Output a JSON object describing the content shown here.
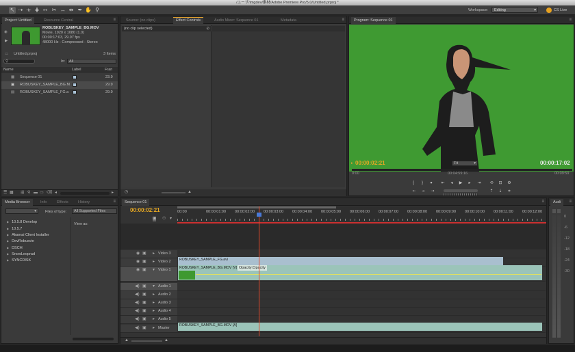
{
  "titlebar": {
    "title": "/ユーザ/imgdev/素材/Adobe Premiere Pro/5.0/Untitled.prproj *"
  },
  "toolbar": {
    "workspace_label": "Workspace:",
    "workspace_value": "Editing",
    "cs_live": "CS Live",
    "tools": [
      "selection-tool",
      "track-select-tool",
      "ripple-edit-tool",
      "rolling-edit-tool",
      "rate-stretch-tool",
      "razor-tool",
      "slip-tool",
      "slide-tool",
      "pen-tool",
      "hand-tool",
      "zoom-tool"
    ]
  },
  "project_panel": {
    "tabs": [
      "Project: Untitled",
      "Resource Central"
    ],
    "clip_name": "ROBUSKEY_SAMPLE_BG.MOV",
    "clip_info": [
      "Movie, 1920 x 1080 (1.0)",
      "00:00:17:03, 29.97 fps",
      "48000 Hz - Compressed - Stereo"
    ],
    "project_file": "Untitled.prproj",
    "item_count": "3 Items",
    "in_label": "In:",
    "in_value": "All",
    "columns": [
      "Name",
      "Label",
      "Fran"
    ],
    "items": [
      {
        "name": "Sequence 01",
        "label_color": "#a9c2d6",
        "rate": "23.9"
      },
      {
        "name": "ROBUSKEY_SAMPLE_BG.M",
        "label_color": "#a9c2d6",
        "rate": "29.9"
      },
      {
        "name": "ROBUSKEY_SAMPLE_FG.a",
        "label_color": "#a9c2d6",
        "rate": "29.9"
      }
    ]
  },
  "effect_panel": {
    "tabs": [
      "Source: (no clips)",
      "Effect Controls",
      "Audio Mixer: Sequence 01",
      "Metadata"
    ],
    "selection": "(no clip selected)"
  },
  "program_panel": {
    "tab": "Program: Sequence 01",
    "timecode_left": "00:00:02:21",
    "fit": "Fit",
    "timecode_right": "00:00:17:02",
    "ruler": [
      "0:00",
      "00:04:59:16",
      "00:09:59"
    ],
    "background_color": "#3f9a32"
  },
  "media_browser": {
    "tabs": [
      "Media Browser",
      "Info",
      "Effects",
      "History"
    ],
    "files_of_type_label": "Files of type:",
    "files_of_type_value": "All Supported Files",
    "view_as_label": "View as:",
    "items": [
      "10.5.8 Develop",
      "10.5.7",
      "Akamai Client Installer",
      "DevRobusvie",
      "DSCH",
      "SnowLeoprad",
      "SYNCDISK"
    ]
  },
  "timeline": {
    "tab": "Sequence 01",
    "timecode": "00:00:02:21",
    "ruler": [
      "00:00",
      "00:00:01:00",
      "00:00:02:00",
      "00:00:03:00",
      "00:00:04:00",
      "00:00:05:00",
      "00:00:06:00",
      "00:00:07:00",
      "00:00:08:00",
      "00:00:09:00",
      "00:00:10:00",
      "00:00:11:00",
      "00:00:12:00"
    ],
    "tracks": [
      "Video 3",
      "Video 2",
      "Video 1",
      "Audio 1",
      "Audio 2",
      "Audio 3",
      "Audio 4",
      "Audio 5",
      "Master"
    ],
    "clips": {
      "fg": "ROBUSKEY_SAMPLE_FG.avi",
      "bg": "ROBUSKEY_SAMPLE_BG.MOV [V]",
      "bg_effect": "Opacity:Opacity",
      "audio": "ROBUSKEY_SAMPLE_BG.MOV [A]"
    }
  },
  "audio_meter": {
    "tab": "Audi",
    "scale": [
      "0",
      "-6",
      "-12",
      "-18",
      "-24",
      "-30"
    ]
  }
}
